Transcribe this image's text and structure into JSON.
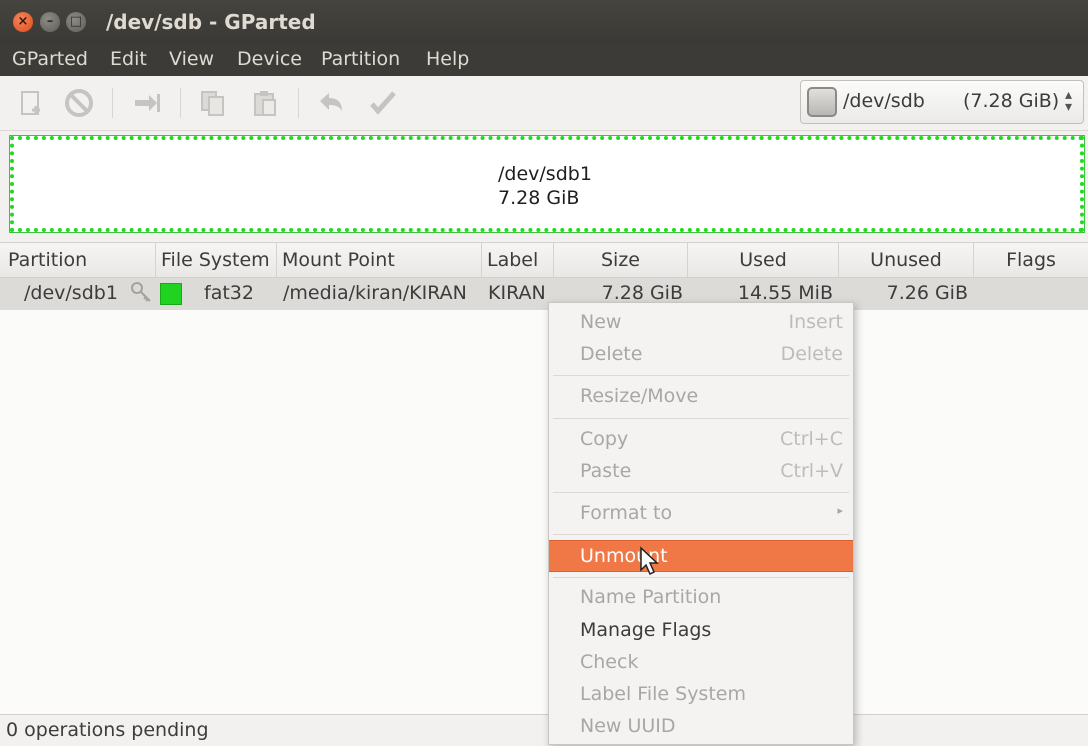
{
  "window": {
    "title": "/dev/sdb - GParted"
  },
  "menubar": {
    "items": [
      "GParted",
      "Edit",
      "View",
      "Device",
      "Partition",
      "Help"
    ]
  },
  "toolbar": {
    "icons": [
      "new-icon",
      "delete-icon",
      "resize-icon",
      "copy-icon",
      "paste-icon",
      "undo-icon",
      "apply-icon"
    ]
  },
  "device_selector": {
    "device": "/dev/sdb",
    "size": "(7.28 GiB)"
  },
  "disk_map": {
    "partition": "/dev/sdb1",
    "size": "7.28 GiB",
    "color": "#1fdb1f"
  },
  "table": {
    "columns": [
      "Partition",
      "File System",
      "Mount Point",
      "Label",
      "Size",
      "Used",
      "Unused",
      "Flags"
    ],
    "rows": [
      {
        "partition": "/dev/sdb1",
        "file_system": "fat32",
        "fs_color": "#21d321",
        "mount_point": "/media/kiran/KIRAN",
        "label": "KIRAN",
        "size": "7.28 GiB",
        "used": "14.55 MiB",
        "unused": "7.26 GiB",
        "flags": ""
      }
    ]
  },
  "context_menu": {
    "items": [
      {
        "label": "New",
        "accel": "Insert",
        "enabled": false
      },
      {
        "label": "Delete",
        "accel": "Delete",
        "enabled": false
      },
      {
        "label": "Resize/Move",
        "accel": "",
        "enabled": false
      },
      {
        "label": "Copy",
        "accel": "Ctrl+C",
        "enabled": false
      },
      {
        "label": "Paste",
        "accel": "Ctrl+V",
        "enabled": false
      },
      {
        "label": "Format to",
        "accel": "",
        "enabled": false
      },
      {
        "label": "Unmount",
        "accel": "",
        "enabled": true,
        "selected": true
      },
      {
        "label": "Name Partition",
        "accel": "",
        "enabled": false
      },
      {
        "label": "Manage Flags",
        "accel": "",
        "enabled": true
      },
      {
        "label": "Check",
        "accel": "",
        "enabled": false
      },
      {
        "label": "Label File System",
        "accel": "",
        "enabled": false
      },
      {
        "label": "New UUID",
        "accel": "",
        "enabled": false
      }
    ]
  },
  "statusbar": {
    "text": "0 operations pending"
  },
  "colors": {
    "highlight": "#f07746",
    "titlebar": "#3c3b37"
  }
}
